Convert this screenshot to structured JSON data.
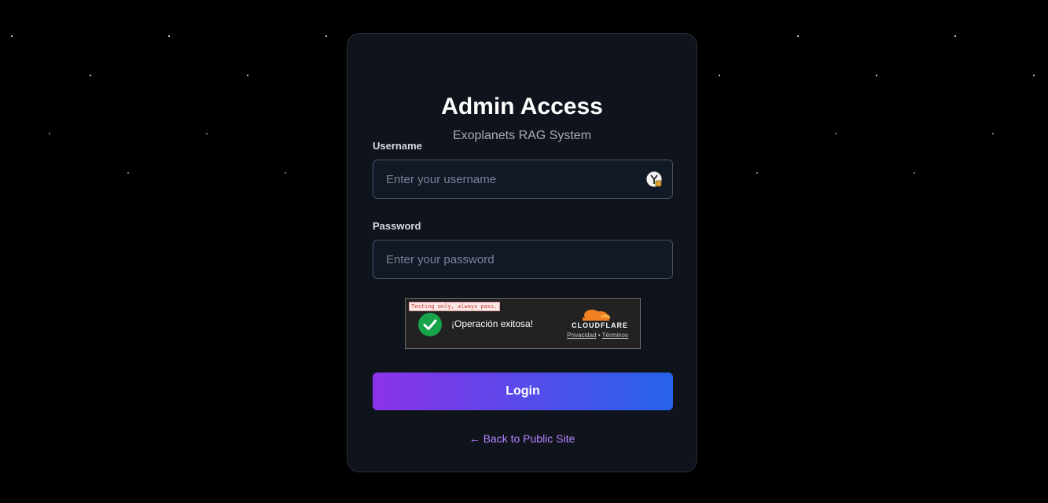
{
  "page": {
    "title": "Admin Access",
    "subtitle": "Exoplanets RAG System"
  },
  "form": {
    "username_label": "Username",
    "username_placeholder": "Enter your username",
    "username_value": "",
    "password_label": "Password",
    "password_placeholder": "Enter your password",
    "password_value": ""
  },
  "captcha": {
    "test_badge": "Testing only, always pass.",
    "message": "¡Operación exitosa!",
    "brand": "CLOUDFLARE",
    "privacy_link": "Privacidad",
    "separator": "•",
    "terms_link": "Términos",
    "status_icon": "check-circle-icon"
  },
  "actions": {
    "login_label": "Login",
    "back_link": "← Back to Public Site"
  },
  "colors": {
    "background": "#000000",
    "card": "#0f141c",
    "gradient_start": "#8b32ea",
    "gradient_end": "#2563eb",
    "link": "#b983ff",
    "success": "#16a34a"
  }
}
